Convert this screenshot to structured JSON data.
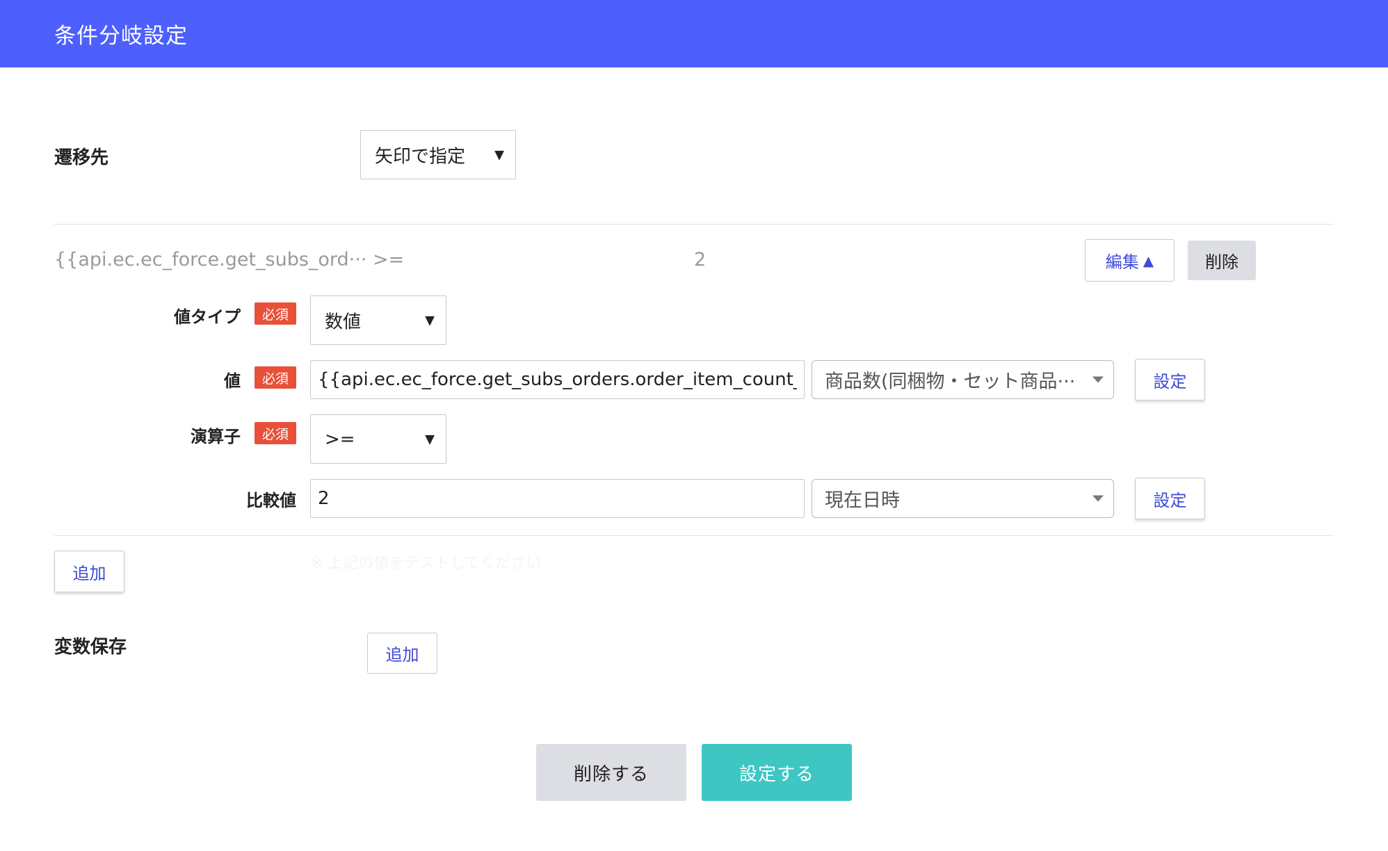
{
  "header": {
    "title": "条件分岐設定"
  },
  "transition": {
    "label": "遷移先",
    "selected": "矢印で指定",
    "arrow": "▼"
  },
  "condition": {
    "summary_left": "{{api.ec.ec_force.get_subs_ord··· >=",
    "summary_value": "2",
    "edit_label": "編集",
    "edit_icon": "▲",
    "delete_label": "削除",
    "value_type": {
      "label": "値タイプ",
      "badge": "必須",
      "selected": "数値",
      "arrow": "▼"
    },
    "value": {
      "label": "値",
      "badge": "必須",
      "input": "{{api.ec.ec_force.get_subs_orders.order_item_count_w",
      "preset": "商品数(同梱物・セット商品···",
      "set_label": "設定"
    },
    "operator": {
      "label": "演算子",
      "badge": "必須",
      "selected": ">=",
      "arrow": "▼"
    },
    "compare": {
      "label": "比較値",
      "input": "2",
      "preset": "現在日時",
      "set_label": "設定"
    },
    "faint_text": "※ 上記の値をテストしてください"
  },
  "add_condition_label": "追加",
  "variables": {
    "label": "変数保存",
    "add_label": "追加"
  },
  "footer": {
    "delete_label": "削除する",
    "submit_label": "設定する"
  },
  "colors": {
    "header": "#4d5ffd",
    "badge": "#e8503a",
    "submit": "#3ec6c3",
    "link": "#3d4bd6"
  }
}
